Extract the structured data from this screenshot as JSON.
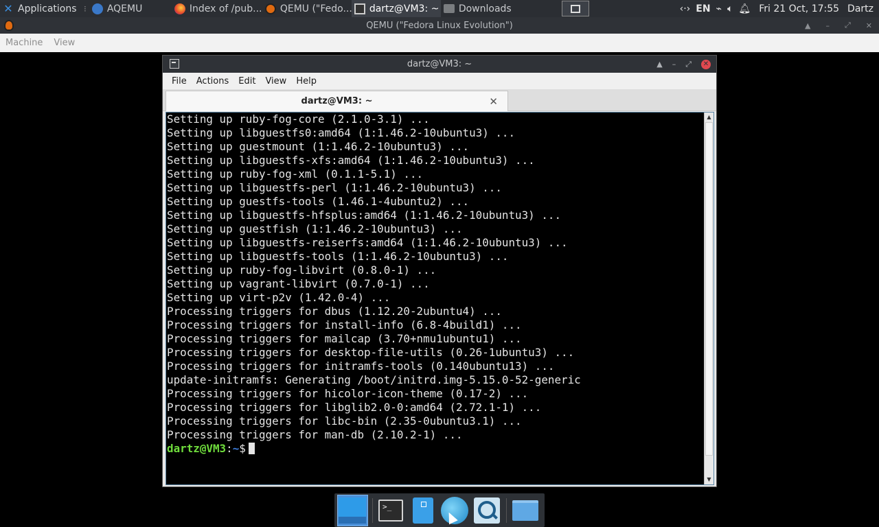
{
  "top_panel": {
    "applications_label": "Applications",
    "tasks": [
      {
        "label": "AQEMU",
        "icon": "aqemu-icon"
      },
      {
        "label": "Index of /pub...",
        "icon": "firefox-icon"
      },
      {
        "label": "QEMU (\"Fedo...",
        "icon": "qemu-icon"
      },
      {
        "label": "dartz@VM3: ~",
        "icon": "terminal-icon",
        "active": true
      },
      {
        "label": "Downloads",
        "icon": "folder-icon"
      }
    ],
    "keyboard_layout": "EN",
    "clock": "Fri 21 Oct, 17:55",
    "user": "Dartz"
  },
  "qemu": {
    "title": "QEMU (\"Fedora Linux Evolution\")",
    "menu": [
      "Machine",
      "View"
    ]
  },
  "terminal": {
    "window_title": "dartz@VM3: ~",
    "menu": [
      "File",
      "Actions",
      "Edit",
      "View",
      "Help"
    ],
    "tab_title": "dartz@VM3: ~",
    "lines": [
      "Setting up ruby-fog-core (2.1.0-3.1) ...",
      "Setting up libguestfs0:amd64 (1:1.46.2-10ubuntu3) ...",
      "Setting up guestmount (1:1.46.2-10ubuntu3) ...",
      "Setting up libguestfs-xfs:amd64 (1:1.46.2-10ubuntu3) ...",
      "Setting up ruby-fog-xml (0.1.1-5.1) ...",
      "Setting up libguestfs-perl (1:1.46.2-10ubuntu3) ...",
      "Setting up guestfs-tools (1.46.1-4ubuntu2) ...",
      "Setting up libguestfs-hfsplus:amd64 (1:1.46.2-10ubuntu3) ...",
      "Setting up guestfish (1:1.46.2-10ubuntu3) ...",
      "Setting up libguestfs-reiserfs:amd64 (1:1.46.2-10ubuntu3) ...",
      "Setting up libguestfs-tools (1:1.46.2-10ubuntu3) ...",
      "Setting up ruby-fog-libvirt (0.8.0-1) ...",
      "Setting up vagrant-libvirt (0.7.0-1) ...",
      "Setting up virt-p2v (1.42.0-4) ...",
      "Processing triggers for dbus (1.12.20-2ubuntu4) ...",
      "Processing triggers for install-info (6.8-4build1) ...",
      "Processing triggers for mailcap (3.70+nmu1ubuntu1) ...",
      "Processing triggers for desktop-file-utils (0.26-1ubuntu3) ...",
      "Processing triggers for initramfs-tools (0.140ubuntu13) ...",
      "update-initramfs: Generating /boot/initrd.img-5.15.0-52-generic",
      "Processing triggers for hicolor-icon-theme (0.17-2) ...",
      "Processing triggers for libglib2.0-0:amd64 (2.72.1-1) ...",
      "Processing triggers for libc-bin (2.35-0ubuntu3.1) ...",
      "Processing triggers for man-db (2.10.2-1) ..."
    ],
    "prompt_user": "dartz@VM3",
    "prompt_sep": ":",
    "prompt_path": "~",
    "prompt_symbol": "$"
  },
  "dock": {
    "items": [
      "desktop-icon",
      "terminal-icon",
      "file-manager-icon",
      "web-browser-icon",
      "app-finder-icon",
      "folder-icon"
    ]
  },
  "colors": {
    "prompt_user": "#6fdc3c",
    "prompt_path": "#3d7ddb",
    "close_button": "#e0484f",
    "panel_bg": "#2b2e33"
  }
}
